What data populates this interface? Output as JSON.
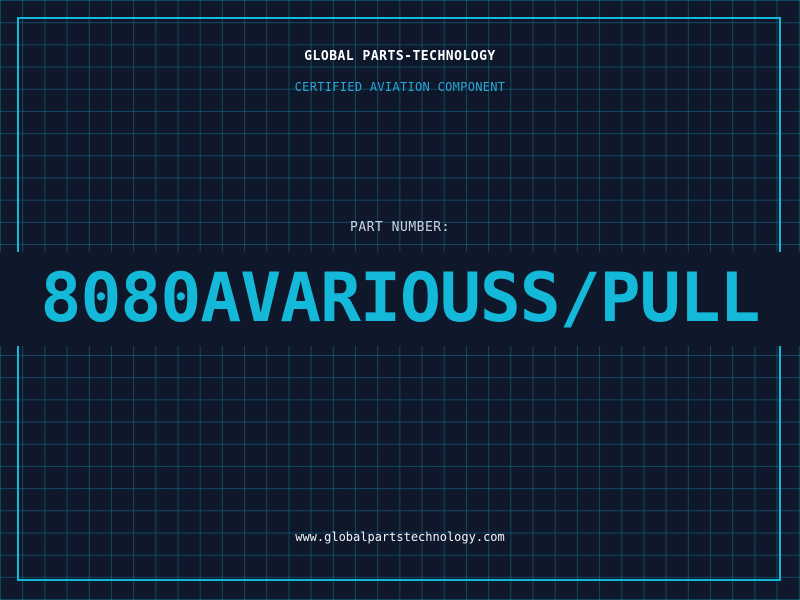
{
  "header": {
    "brand": "GLOBAL PARTS-TECHNOLOGY",
    "subtitle": "CERTIFIED AVIATION COMPONENT"
  },
  "part": {
    "label": "PART NUMBER:",
    "number": "8080AVARIOUSS/PULL"
  },
  "footer": {
    "url": "www.globalpartstechnology.com"
  },
  "colors": {
    "background": "#0f172a",
    "grid": "#146e8c",
    "accent": "#14b8d8",
    "subtitle": "#2aa7d6",
    "text": "#ffffff"
  }
}
